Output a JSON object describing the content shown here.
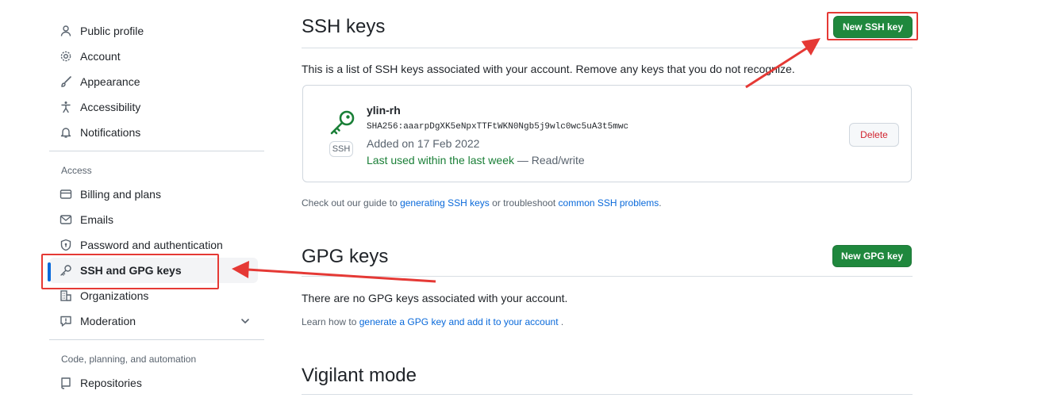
{
  "sidebar": {
    "items_top": [
      {
        "label": "Public profile",
        "icon": "person-icon"
      },
      {
        "label": "Account",
        "icon": "gear-icon"
      },
      {
        "label": "Appearance",
        "icon": "paintbrush-icon"
      },
      {
        "label": "Accessibility",
        "icon": "accessibility-icon"
      },
      {
        "label": "Notifications",
        "icon": "bell-icon"
      }
    ],
    "access_heading": "Access",
    "items_access": [
      {
        "label": "Billing and plans",
        "icon": "credit-card-icon"
      },
      {
        "label": "Emails",
        "icon": "mail-icon"
      },
      {
        "label": "Password and authentication",
        "icon": "shield-lock-icon"
      },
      {
        "label": "SSH and GPG keys",
        "icon": "key-icon",
        "active": true
      },
      {
        "label": "Organizations",
        "icon": "organization-icon"
      },
      {
        "label": "Moderation",
        "icon": "report-icon"
      }
    ],
    "code_heading": "Code, planning, and automation",
    "items_code": [
      {
        "label": "Repositories",
        "icon": "repo-icon"
      }
    ]
  },
  "ssh": {
    "title": "SSH keys",
    "new_button": "New SSH key",
    "description": "This is a list of SSH keys associated with your account. Remove any keys that you do not recognize.",
    "key": {
      "title": "ylin-rh",
      "fingerprint": "SHA256:aaarpDgXK5eNpxTTFtWKN0Ngb5j9wlc0wc5uA3t5mwc",
      "badge": "SSH",
      "added": "Added on 17 Feb 2022",
      "last_used": "Last used within the last week",
      "access": " — Read/write",
      "delete_label": "Delete"
    },
    "guide_prefix": "Check out our guide to ",
    "guide_link1": "generating SSH keys",
    "guide_middle": " or troubleshoot ",
    "guide_link2": "common SSH problems",
    "guide_suffix": "."
  },
  "gpg": {
    "title": "GPG keys",
    "new_button": "New GPG key",
    "empty_text": "There are no GPG keys associated with your account.",
    "learn_prefix": "Learn how to ",
    "learn_link": "generate a GPG key and add it to your account",
    "learn_suffix": " ."
  },
  "vigilant": {
    "title": "Vigilant mode"
  },
  "colors": {
    "accent_blue": "#0969da",
    "button_green": "#1f883d",
    "annotation_red": "#e53935",
    "danger_red": "#d1242f"
  }
}
